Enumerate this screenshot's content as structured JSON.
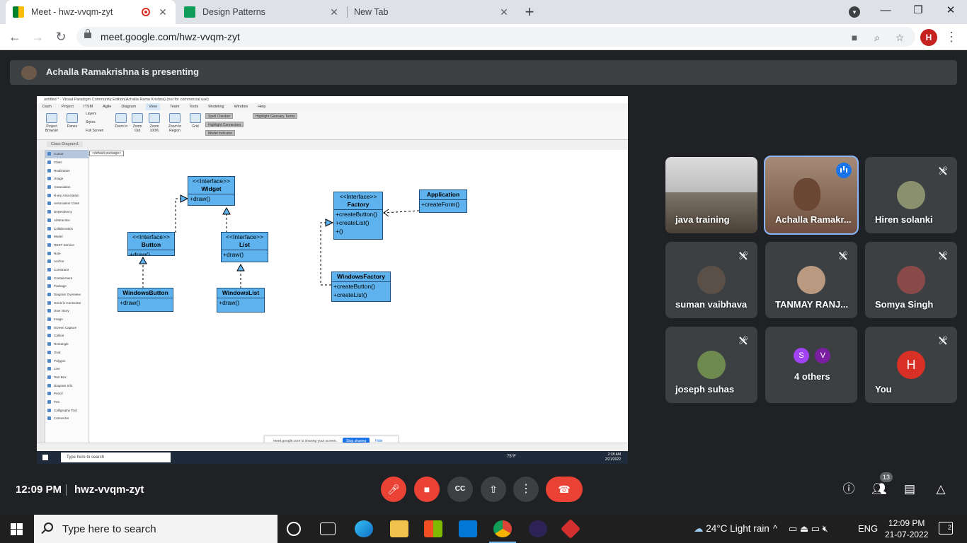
{
  "browser": {
    "tabs": [
      {
        "title": "Meet - hwz-vvqm-zyt",
        "active": true,
        "recording": true
      },
      {
        "title": "Design Patterns",
        "active": false
      },
      {
        "title": "New Tab",
        "active": false
      }
    ],
    "url": "meet.google.com/hwz-vvqm-zyt",
    "profile_initial": "H",
    "profile_color": "#c5221f"
  },
  "presenting": {
    "text": "Achalla Ramakrishna is presenting"
  },
  "shared_screen": {
    "vp_title": "untitled * - Visual Paradigm Community Edition(Achalla Rama Krishna) (not for commercial use)",
    "menu": [
      "Dash",
      "Project",
      "ITSM",
      "Agile",
      "Diagram",
      "View",
      "Team",
      "Tools",
      "Modeling",
      "Window",
      "Help"
    ],
    "menu_selected": "View",
    "ribbon": {
      "buttons": [
        "Project Browser",
        "Panes",
        "Zoom In",
        "Zoom Out",
        "Zoom 100%",
        "Zoom to Region",
        "Grid"
      ],
      "small": [
        "Layers",
        "Styles",
        "Full Screen"
      ],
      "options": [
        "Spell Checker",
        "Highlight Glossary Terms",
        "Highlight Connectors",
        "Model Indicator"
      ]
    },
    "diagram_tab": "Class Diagram1",
    "package_label": "<default package>",
    "palette": [
      "Cursor",
      "Class",
      "Realization",
      "Usage",
      "Association",
      "N-ary Association",
      "Association Class",
      "Dependency",
      "Abstraction",
      "Collaboration",
      "Model",
      "REST Service",
      "Note",
      "Anchor",
      "Constraint",
      "Containment",
      "Package",
      "Diagram Overview",
      "Generic Connector",
      "User Story",
      "Image",
      "Screen Capture",
      "Callout",
      "Rectangle",
      "Oval",
      "Polygon",
      "Line",
      "Text Box",
      "Diagram Info",
      "Pencil",
      "Pen",
      "Calligraphy Tool",
      "Connector"
    ],
    "classes": {
      "widget": {
        "stereotype": "<<Interface>>",
        "name": "Widget",
        "ops": [
          "+draw()"
        ]
      },
      "button": {
        "stereotype": "<<Interface>>",
        "name": "Button",
        "ops": [
          "+draw()"
        ]
      },
      "list": {
        "stereotype": "<<Interface>>",
        "name": "List",
        "ops": [
          "+draw()"
        ]
      },
      "windowsbutton": {
        "name": "WindowsButton",
        "ops": [
          "+draw()"
        ]
      },
      "windowslist": {
        "name": "WindowsList",
        "ops": [
          "+draw()"
        ]
      },
      "factory": {
        "stereotype": "<<Interface>>",
        "name": "Factory",
        "ops": [
          "+createButton()",
          "+createList()",
          "+()"
        ]
      },
      "application": {
        "name": "Application",
        "ops": [
          "+createForm()"
        ]
      },
      "windowsfactory": {
        "name": "WindowsFactory",
        "ops": [
          "+createButton()",
          "+createList()"
        ]
      }
    },
    "share_notice": {
      "text": "meet.google.com is sharing your screen.",
      "stop": "Stop sharing",
      "hide": "Hide"
    },
    "inner_taskbar": {
      "search": "Type here to search",
      "weather": "75°F",
      "time": "2:38 AM",
      "date": "2/21/2022"
    }
  },
  "participants": [
    {
      "name": "java training",
      "type": "video",
      "muted": false
    },
    {
      "name": "Achalla Ramakr...",
      "type": "video",
      "speaking": true
    },
    {
      "name": "Hiren solanki",
      "type": "avatar",
      "muted": true
    },
    {
      "name": "suman vaibhava",
      "type": "avatar",
      "muted": true
    },
    {
      "name": "TANMAY RANJ...",
      "type": "avatar",
      "muted": true
    },
    {
      "name": "Somya Singh",
      "type": "avatar",
      "muted": true
    },
    {
      "name": "joseph suhas",
      "type": "avatar",
      "muted": true
    },
    {
      "name": "4 others",
      "type": "group",
      "initials": [
        "S",
        "V"
      ]
    },
    {
      "name": "You",
      "type": "letter",
      "initial": "H",
      "muted": true
    }
  ],
  "meet_bar": {
    "time": "12:09 PM",
    "code": "hwz-vvqm-zyt",
    "people_count": "13"
  },
  "taskbar": {
    "search": "Type here to search",
    "weather": "24°C  Light rain",
    "lang": "ENG",
    "time": "12:09 PM",
    "date": "21-07-2022",
    "notifications": "2"
  }
}
